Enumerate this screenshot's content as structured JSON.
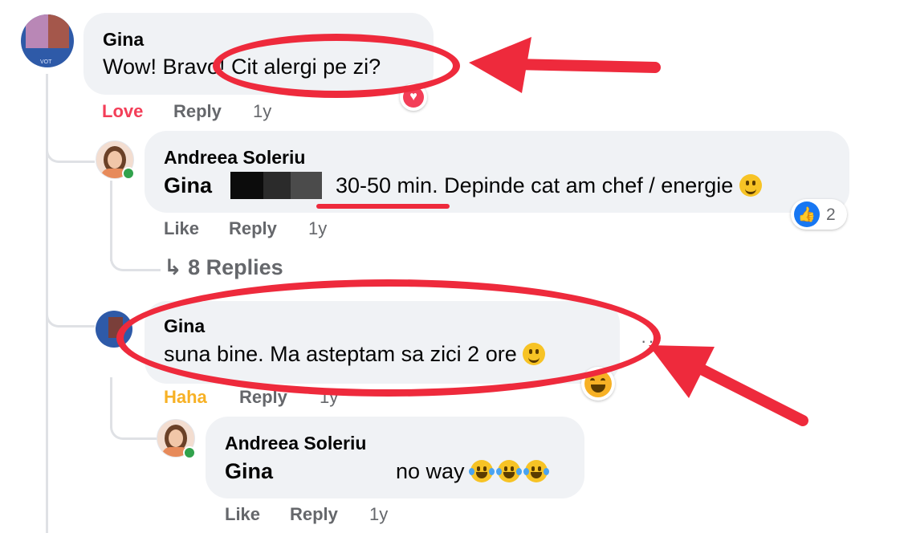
{
  "comments": [
    {
      "author": "Gina",
      "text": "Wow! Bravo! Cit alergi pe zi?",
      "reaction_label": "Love",
      "reply_label": "Reply",
      "time": "1y"
    },
    {
      "author": "Andreea Soleriu",
      "mention": "Gina",
      "text": "30-50 min. Depinde cat am chef / energie",
      "like_label": "Like",
      "reply_label": "Reply",
      "time": "1y",
      "reaction_count": "2"
    },
    {
      "author": "Gina",
      "text": "suna bine. Ma asteptam sa zici 2 ore",
      "reaction_label": "Haha",
      "reply_label": "Reply",
      "time": "1y"
    },
    {
      "author": "Andreea Soleriu",
      "mention": "Gina",
      "text": "no way",
      "like_label": "Like",
      "reply_label": "Reply",
      "time": "1y"
    }
  ],
  "replies_link": {
    "arrow": "↳",
    "label": "8 Replies"
  },
  "avatar_badge": "VOT",
  "colors": {
    "bubble": "#f0f2f5",
    "meta": "#65676b",
    "love": "#f33e58",
    "haha": "#f7b125",
    "like_blue": "#1877f2",
    "annotation_red": "#ee2a3c"
  }
}
